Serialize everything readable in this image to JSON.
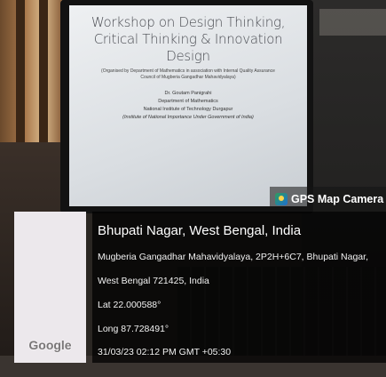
{
  "slide": {
    "title_lines": [
      "Workshop on Design Thinking,",
      "Critical Thinking & Innovation",
      "Design"
    ],
    "organizer": "(Organised by Department of Mathematics in association with Internal Quality Assurance Council of Mugberia Gangadhar Mahavidyalaya)",
    "speaker": "Dr. Goutam Panigrahi",
    "department": "Department of Mathematics",
    "institute": "National Institute of Technology Durgapur",
    "institute_note": "(Institute of National Importance Under Government of India)"
  },
  "gps": {
    "app_name": "GPS Map Camera",
    "icon": "gps-map-camera-icon",
    "map_logo": "Google",
    "location_title": "Bhupati Nagar, West Bengal, India",
    "address_line1": "Mugberia Gangadhar Mahavidyalaya, 2P2H+6C7, Bhupati Nagar,",
    "address_line2": "West Bengal 721425, India",
    "latitude": "Lat 22.000588°",
    "longitude": "Long 87.728491°",
    "timestamp": "31/03/23 02:12 PM GMT +05:30"
  }
}
